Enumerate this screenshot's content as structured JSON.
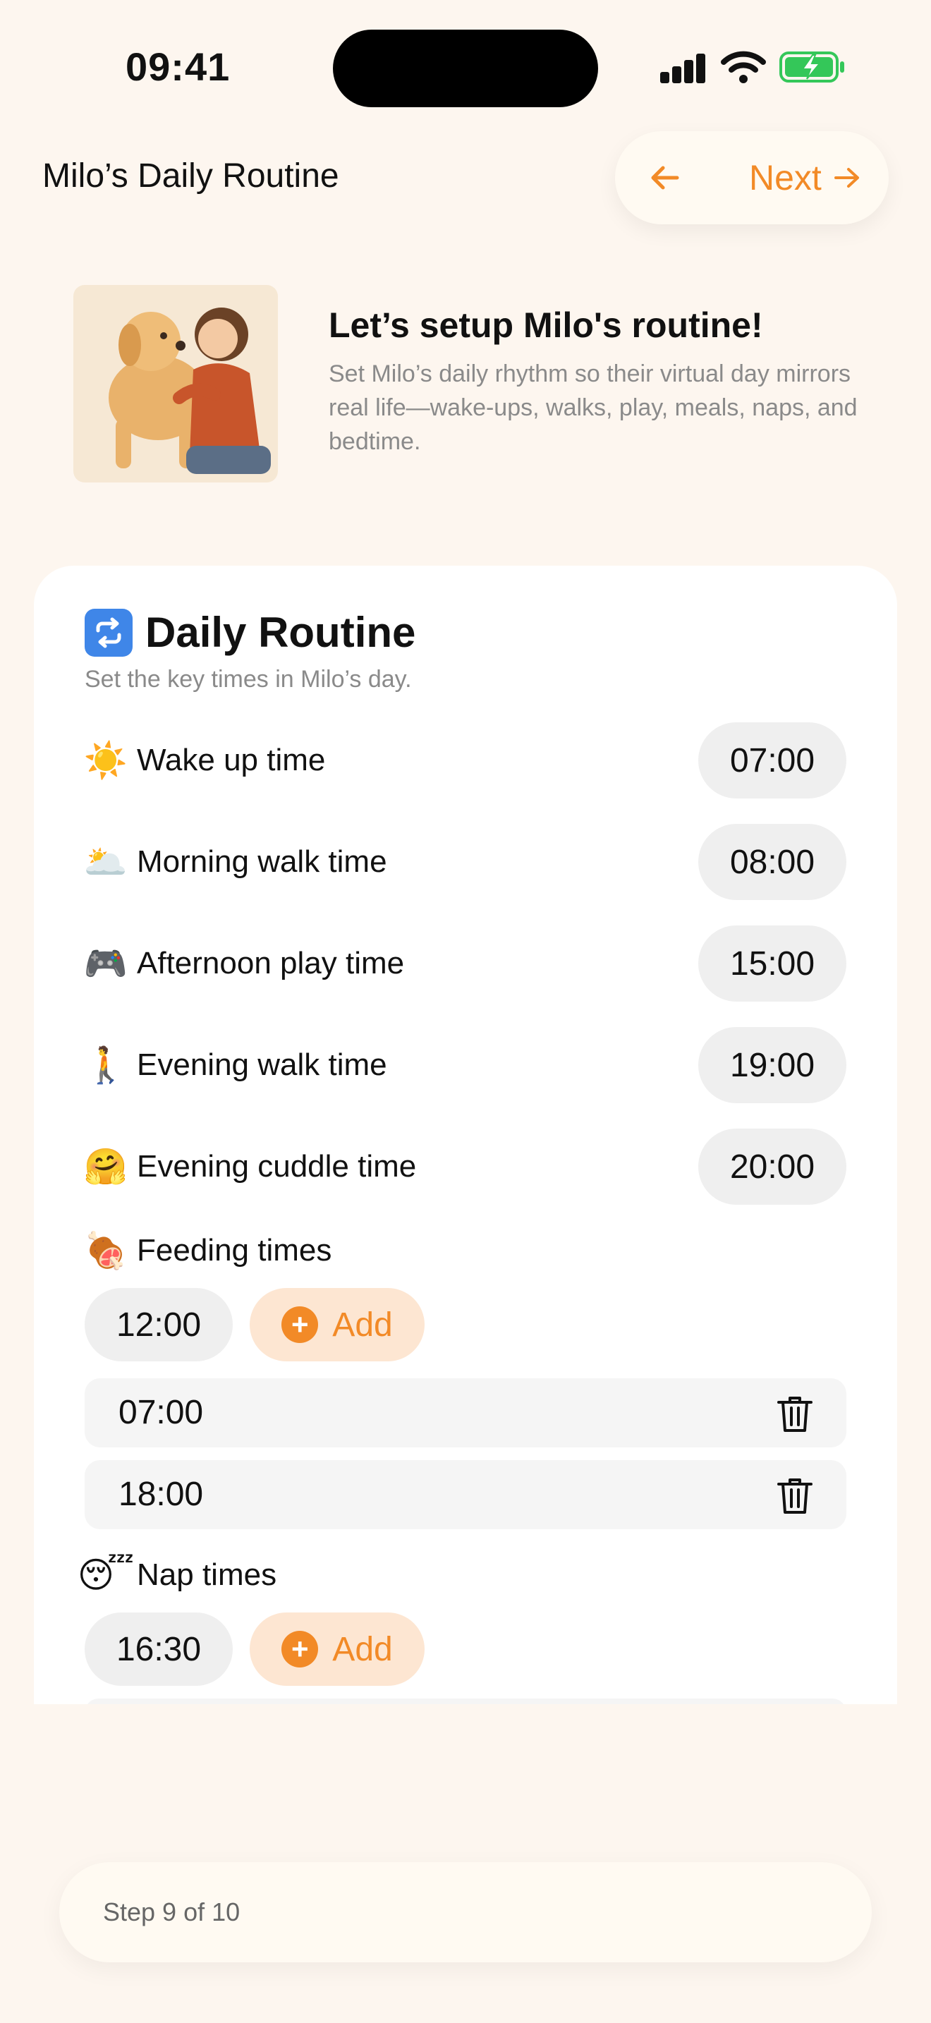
{
  "status_bar": {
    "time": "09:41"
  },
  "header": {
    "title": "Milo’s Daily Routine",
    "next_label": "Next"
  },
  "intro": {
    "title": "Let’s setup Milo's routine!",
    "description": "Set Milo’s daily rhythm so their virtual day mirrors real life—wake-ups, walks, play, meals, naps, and bedtime."
  },
  "card": {
    "title": "Daily Routine",
    "subtitle": "Set the key times in Milo’s day.",
    "rows": [
      {
        "emoji": "☀️",
        "label": "Wake up time",
        "time": "07:00"
      },
      {
        "emoji": "🌥️",
        "label": "Morning walk time",
        "time": "08:00"
      },
      {
        "emoji": "🎮",
        "label": "Afternoon play time",
        "time": "15:00"
      },
      {
        "emoji": "🚶",
        "label": "Evening walk time",
        "time": "19:00"
      },
      {
        "emoji": "🤗",
        "label": "Evening cuddle time",
        "time": "20:00"
      }
    ],
    "feeding": {
      "emoji": "🍖",
      "label": "Feeding times",
      "new_time": "12:00",
      "add_label": "Add",
      "entries": [
        "07:00",
        "18:00"
      ]
    },
    "naps": {
      "emoji": "😴",
      "label": "Nap times",
      "new_time": "16:30",
      "add_label": "Add"
    }
  },
  "footer": {
    "step_text": "Step 9 of 10"
  },
  "colors": {
    "accent": "#f28a27",
    "background": "#fdf6ef",
    "battery": "#34c759"
  }
}
